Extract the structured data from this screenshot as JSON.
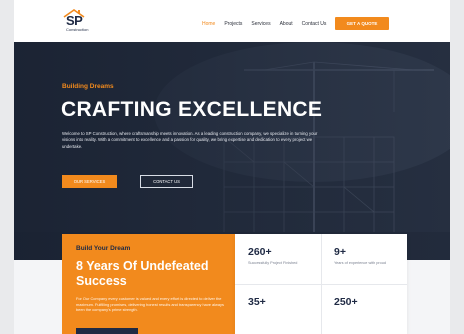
{
  "brand": {
    "logo_text": "SP",
    "logo_subtext": "Construction",
    "colors": {
      "accent": "#f28a1d",
      "navy": "#1f2a44"
    }
  },
  "nav": {
    "items": [
      {
        "label": "Home",
        "active": true
      },
      {
        "label": "Projects",
        "active": false
      },
      {
        "label": "Services",
        "active": false
      },
      {
        "label": "About",
        "active": false
      },
      {
        "label": "Contact Us",
        "active": false
      }
    ],
    "cta_label": "GET A QUOTE"
  },
  "hero": {
    "eyebrow": "Building Dreams",
    "title": "CRAFTING EXCELLENCE",
    "description": "Welcome to SP Construction, where craftsmanship meets innovation. As a leading construction company, we specialize in turning your visions into reality. With a commitment to excellence and a passion for quality, we bring expertise and dedication to every project we undertake.",
    "primary_button": "OUR SERVICES",
    "secondary_button": "CONTACT US"
  },
  "about_card": {
    "eyebrow": "Build Your Dream",
    "title": "8 Years Of Undefeated Success",
    "description": "For Our Company every customer is valued and every effort is directed to deliver the maximum. Fulfilling promises, delivering honest results and transparency have always been the company's prime strength."
  },
  "stats": [
    {
      "value": "260+",
      "label": "Successfully Project Finished"
    },
    {
      "value": "9+",
      "label": "Years of experience with proud"
    },
    {
      "value": "35+",
      "label": ""
    },
    {
      "value": "250+",
      "label": ""
    }
  ]
}
